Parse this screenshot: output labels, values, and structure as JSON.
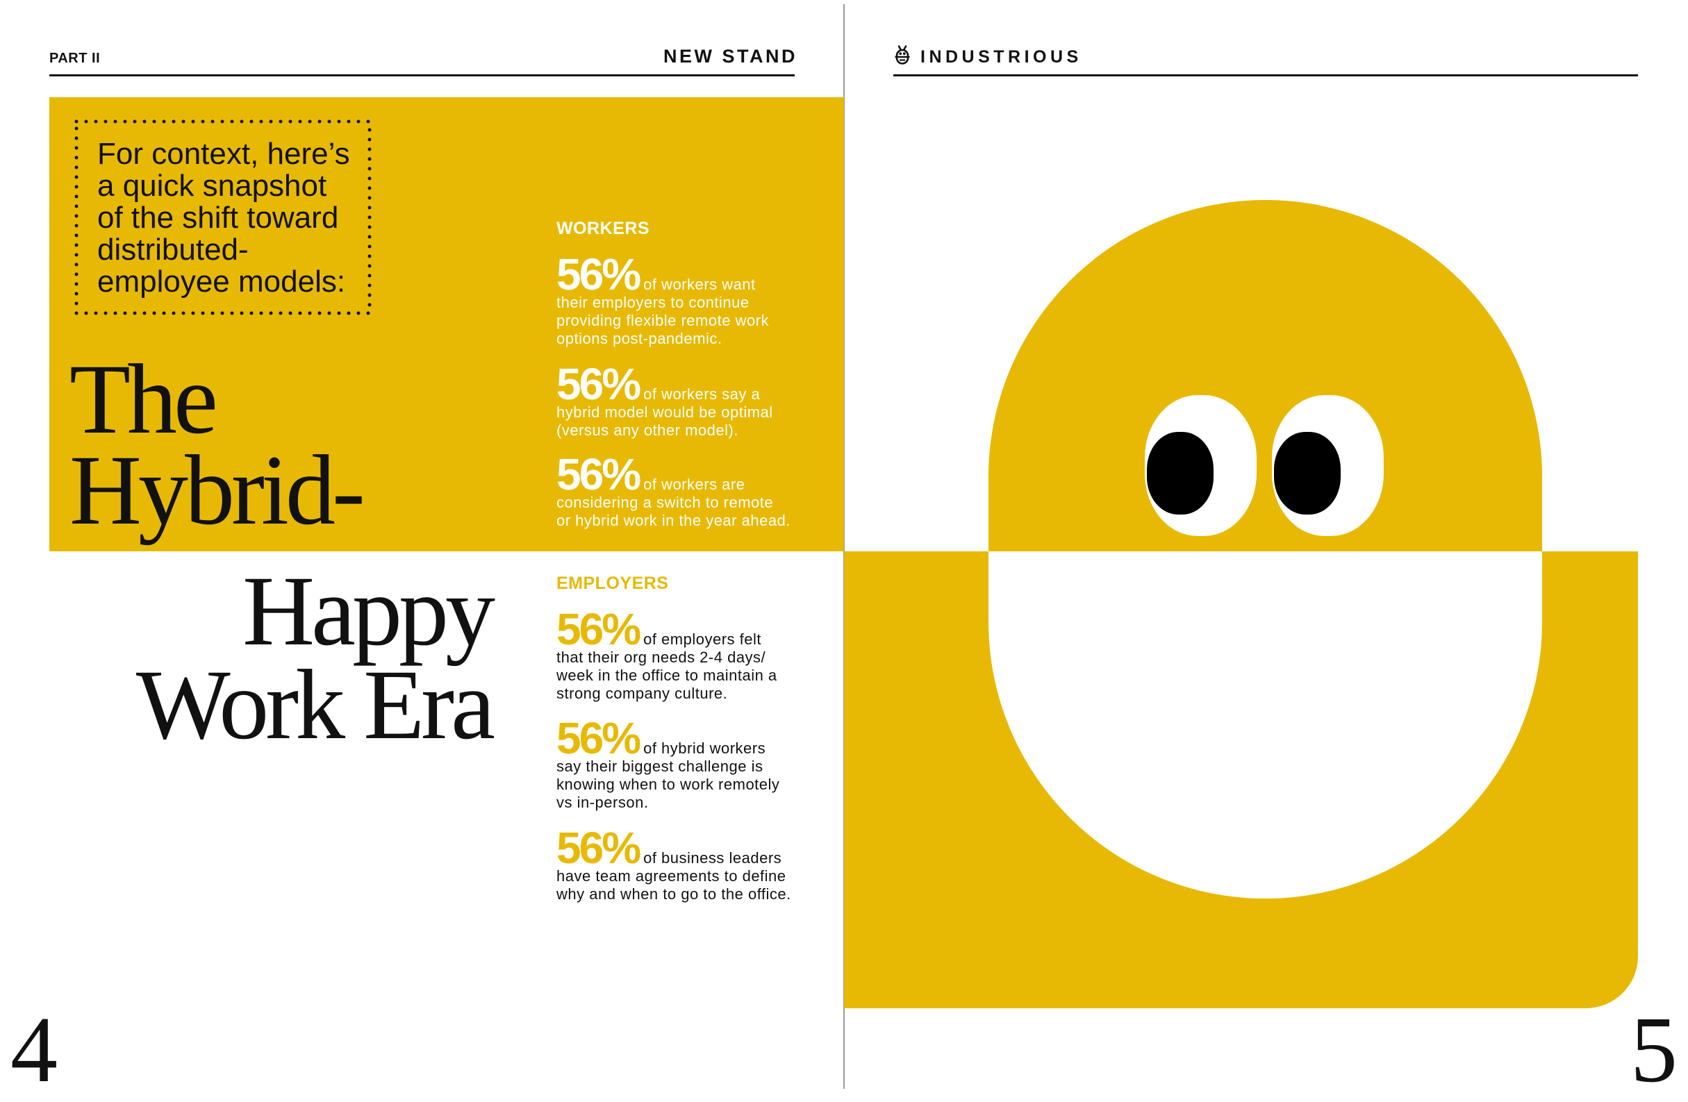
{
  "left_page": {
    "section_label": "PART II",
    "publication": "NEW STAND",
    "intro_lines": [
      "For context, here’s",
      "a quick snapshot",
      "of the shift toward",
      "distributed-",
      "employee models:"
    ],
    "headline_lines": [
      "The",
      "Hybrid-",
      "Happy",
      "Work Era"
    ],
    "page_number": "4"
  },
  "stats": {
    "workers": {
      "heading": "WORKERS",
      "items": [
        {
          "value": "56%",
          "lines": [
            "of workers want",
            "their employers to continue",
            "providing flexible remote work",
            "options post-pandemic."
          ]
        },
        {
          "value": "56%",
          "lines": [
            "of workers say a",
            "hybrid model would be optimal",
            "(versus any other model)."
          ]
        },
        {
          "value": "56%",
          "lines": [
            "of workers are",
            "considering a switch to remote",
            "or hybrid work in the year ahead."
          ]
        }
      ]
    },
    "employers": {
      "heading": "EMPLOYERS",
      "items": [
        {
          "value": "56%",
          "lines": [
            "of employers felt",
            "that their org needs 2-4 days/",
            "week in the office to maintain a",
            "strong company culture."
          ]
        },
        {
          "value": "56%",
          "lines": [
            "of hybrid workers",
            "say their biggest challenge is",
            "knowing when to work remotely",
            "vs in-person."
          ]
        },
        {
          "value": "56%",
          "lines": [
            "of business leaders",
            "have team agreements to define",
            "why and when to go to the office."
          ]
        }
      ]
    }
  },
  "right_page": {
    "brand": "INDUSTRIOUS",
    "brand_icon": "bee-logo-icon",
    "page_number": "5"
  },
  "colors": {
    "accent": "#E8B904",
    "text": "#111111",
    "divider": "#9A9A9A",
    "paper": "#FFFFFF"
  }
}
